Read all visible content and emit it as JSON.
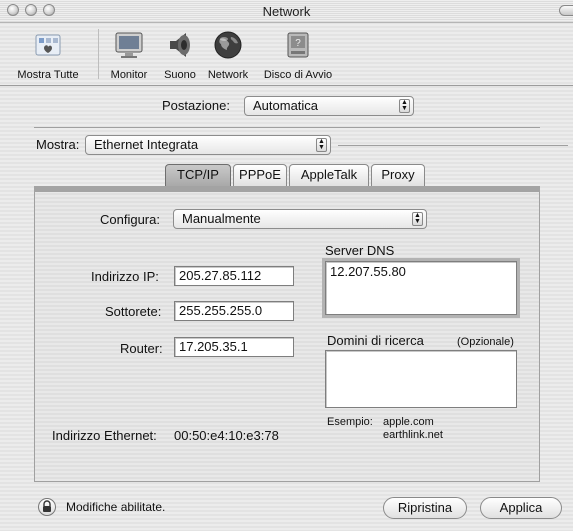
{
  "window": {
    "title": "Network"
  },
  "toolbar": {
    "items": [
      {
        "label": "Mostra Tutte",
        "icon": "show-all-icon"
      },
      {
        "label": "Monitor",
        "icon": "monitor-icon"
      },
      {
        "label": "Suono",
        "icon": "speaker-icon"
      },
      {
        "label": "Network",
        "icon": "globe-icon"
      },
      {
        "label": "Disco di Avvio",
        "icon": "startup-disk-icon"
      }
    ]
  },
  "location": {
    "label": "Postazione:",
    "value": "Automatica"
  },
  "show": {
    "label": "Mostra:",
    "value": "Ethernet Integrata"
  },
  "tabs": [
    "TCP/IP",
    "PPPoE",
    "AppleTalk",
    "Proxy"
  ],
  "configure": {
    "label": "Configura:",
    "value": "Manualmente"
  },
  "ip": {
    "label": "Indirizzo IP:",
    "value": "205.27.85.112"
  },
  "subnet": {
    "label": "Sottorete:",
    "value": "255.255.255.0"
  },
  "router": {
    "label": "Router:",
    "value": "17.205.35.1"
  },
  "dns": {
    "label": "Server DNS",
    "value": "12.207.55.80"
  },
  "search": {
    "label": "Domini di ricerca",
    "optional": "(Opzionale)",
    "value": ""
  },
  "example": {
    "label": "Esempio:",
    "line1": "apple.com",
    "line2": "earthlink.net"
  },
  "ethernet": {
    "label": "Indirizzo Ethernet:",
    "value": "00:50:e4:10:e3:78"
  },
  "footer": {
    "lock_text": "Modifiche abilitate.",
    "revert": "Ripristina",
    "apply": "Applica"
  }
}
